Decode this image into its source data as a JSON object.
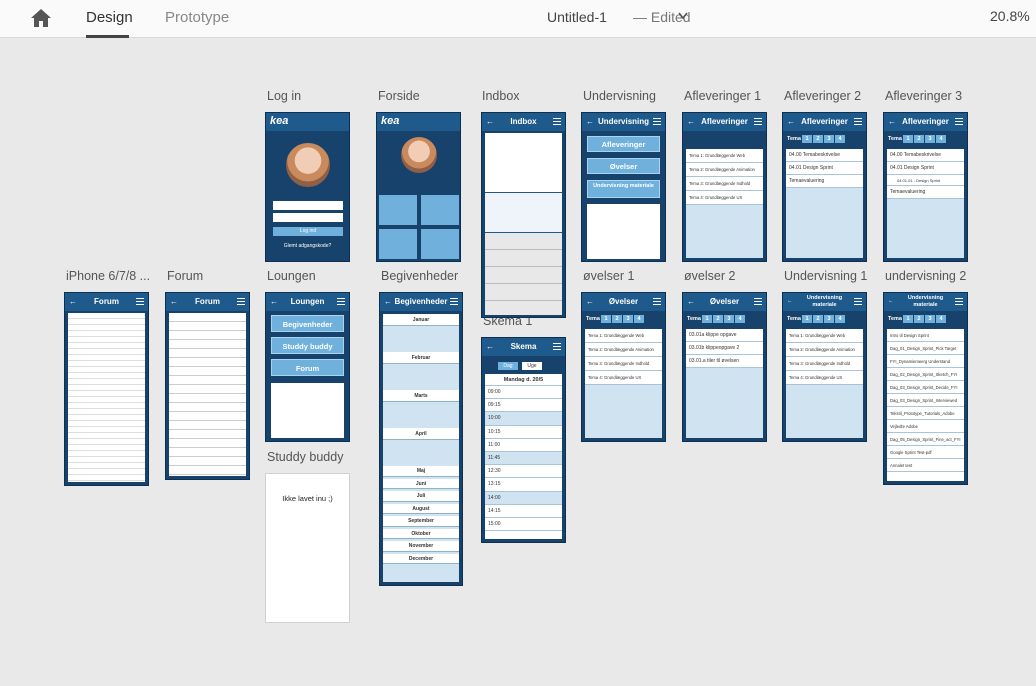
{
  "toolbar": {
    "tab_design": "Design",
    "tab_prototype": "Prototype",
    "doc_title": "Untitled-1",
    "doc_state": "—  Edited",
    "zoom": "20.8%"
  },
  "labels": {
    "login": "Log in",
    "forside": "Forside",
    "indbox": "Indbox",
    "undervisning": "Undervisning",
    "afl1": "Afleveringer 1",
    "afl2": "Afleveringer 2",
    "afl3": "Afleveringer 3",
    "iphone": "iPhone 6/7/8 ...",
    "forum": "Forum",
    "loungen": "Loungen",
    "begivenheder": "Begivenheder",
    "ovelser1": "øvelser 1",
    "ovelser2": "øvelser 2",
    "underv1": "Undervisning 1",
    "underv2": "undervisning 2",
    "studdy": "Studdy buddy",
    "skema": "Skema 1"
  },
  "screens": {
    "kea": "kea",
    "indbox_hdr": "Indbox",
    "underv_hdr": "Undervisning",
    "afl_hdr": "Afleveringer",
    "forum_hdr": "Forum",
    "loungen_hdr": "Loungen",
    "begiv_hdr": "Begivenheder",
    "ovelser_hdr": "Øvelser",
    "underv_mat_hdr": "Undervisning materiale",
    "skema_hdr": "Skema",
    "tema": "Tema",
    "login_btn": "Log ind",
    "forgot": "Glemt adgangskode?",
    "ikke": "Ikke lavet inu ;)",
    "afleveringer_btn": "Afleveringer",
    "ovelser_btn": "Øvelser",
    "undermat_btn": "Undervisning materiale",
    "lounge_btns": [
      "Begivenheder",
      "Studdy buddy",
      "Forum"
    ],
    "afl1_rows": [
      "Tema 1: Grundlæggende Web",
      "Tema 2: Grundlæggende Animation",
      "Tema 3: Grundlæggende Indhold",
      "Tema 4: Grundlæggende UX"
    ],
    "afl2_rows": [
      "04.00 Temabeskrivelse",
      "04.01 Design Sprint",
      "Temaevaluering"
    ],
    "afl3_rows": [
      "04.00 Temabeskrivelse",
      "04.01 Design Sprint",
      "04.01.01 - Design Sprint",
      "Temaevaluering"
    ],
    "ovel2_rows": [
      "03.01a klippe opgave",
      "03.01b klippeopgave 2",
      "03.01.a tiler til øvelsen"
    ],
    "underv2_rows": [
      "Intro til Design Sprint",
      "Dag_01_Design_Sprint_Pick Target",
      "FYI_Dynamiemeerg Understand",
      "Dag_02_Design_Sprint_Sketch_FYI",
      "Dag_03_Design_Sprint_Decide_FYI",
      "Dag_03_Design_Sprint_Interviewed",
      "Tekstil_Prototype_Tutorials_Adobe",
      "Vejledte Adobe",
      "Dag_05_Design_Sprint_Fine_act_FYI",
      "Google Sprint Test-pdf",
      "Annalet test"
    ],
    "months": [
      "Januar",
      "Februar",
      "Marts",
      "April",
      "Maj",
      "Juni",
      "Juli",
      "August",
      "September",
      "Oktober",
      "November",
      "December"
    ],
    "skema_times": [
      "09:00",
      "09:15",
      "10:00",
      "10:15",
      "11:00",
      "11:45",
      "12:30",
      "13:15",
      "14:00",
      "14:15",
      "15:00"
    ],
    "skema_tabs": [
      "Dag",
      "Uge"
    ],
    "skema_day": "Mandag d. 20/5"
  }
}
